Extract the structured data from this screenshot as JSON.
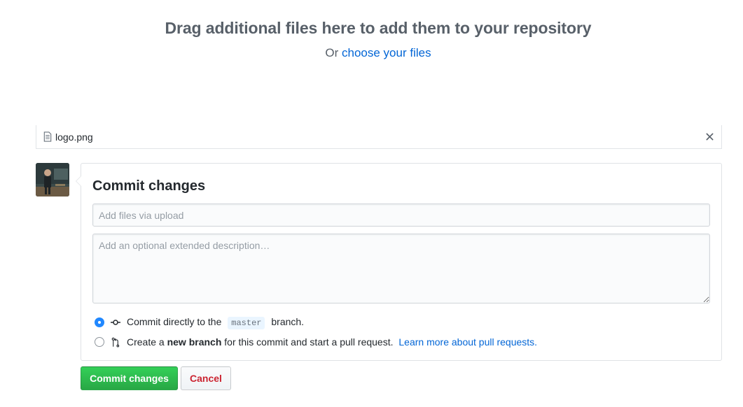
{
  "dropzone": {
    "title": "Drag additional files here to add them to your repository",
    "prefix": "Or",
    "choose_link": "choose your files"
  },
  "file": {
    "icon": "file-icon",
    "name": "logo.png",
    "remove_icon": "close-icon"
  },
  "commit": {
    "title": "Commit changes",
    "summary_placeholder": "Add files via upload",
    "summary_value": "",
    "description_placeholder": "Add an optional extended description…",
    "description_value": "",
    "option_direct": {
      "selected": true,
      "icon": "git-commit-icon",
      "text_before": "Commit directly to the",
      "branch": "master",
      "text_after": "branch."
    },
    "option_new_branch": {
      "selected": false,
      "icon": "git-pull-request-icon",
      "text_before": "Create a",
      "bold": "new branch",
      "text_after": "for this commit and start a pull request.",
      "link": "Learn more about pull requests."
    }
  },
  "buttons": {
    "commit_label": "Commit changes",
    "cancel_label": "Cancel"
  },
  "colors": {
    "link": "#0366d6",
    "primary_button": "#28a745",
    "danger_text": "#cb2431",
    "radio_checked": "#2188ff"
  }
}
